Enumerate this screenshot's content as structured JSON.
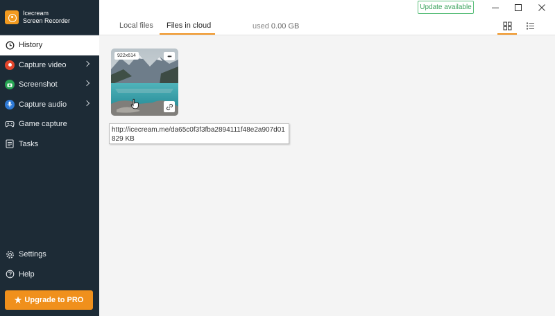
{
  "app": {
    "name_line1": "Icecream",
    "name_line2": "Screen Recorder"
  },
  "sidebar": {
    "items": [
      {
        "label": "History",
        "icon": "clock-icon",
        "active": true
      },
      {
        "label": "Capture video",
        "icon": "record-icon",
        "color": "#e2452b"
      },
      {
        "label": "Screenshot",
        "icon": "camera-icon",
        "color": "#27a553"
      },
      {
        "label": "Capture audio",
        "icon": "microphone-icon",
        "color": "#2e7ad6"
      },
      {
        "label": "Game capture",
        "icon": "gamepad-icon"
      },
      {
        "label": "Tasks",
        "icon": "tasks-icon"
      }
    ],
    "bottom_items": [
      {
        "label": "Settings",
        "icon": "gear-icon"
      },
      {
        "label": "Help",
        "icon": "help-icon"
      }
    ],
    "upgrade_label": "Upgrade to PRO"
  },
  "header": {
    "tabs": [
      {
        "label": "Local files",
        "active": false
      },
      {
        "label": "Files in cloud",
        "active": true
      }
    ],
    "used_label": "used",
    "used_value": "0.00 GB",
    "update_label": "Update available"
  },
  "file": {
    "dimensions": "922x614",
    "url": "http://icecream.me/da65c0f3f3fba2894111f48e2a907d01",
    "size": "829 KB"
  },
  "colors": {
    "accent": "#f0901c",
    "sidebar_bg": "#1d2b36",
    "update_green": "#3da45f"
  }
}
